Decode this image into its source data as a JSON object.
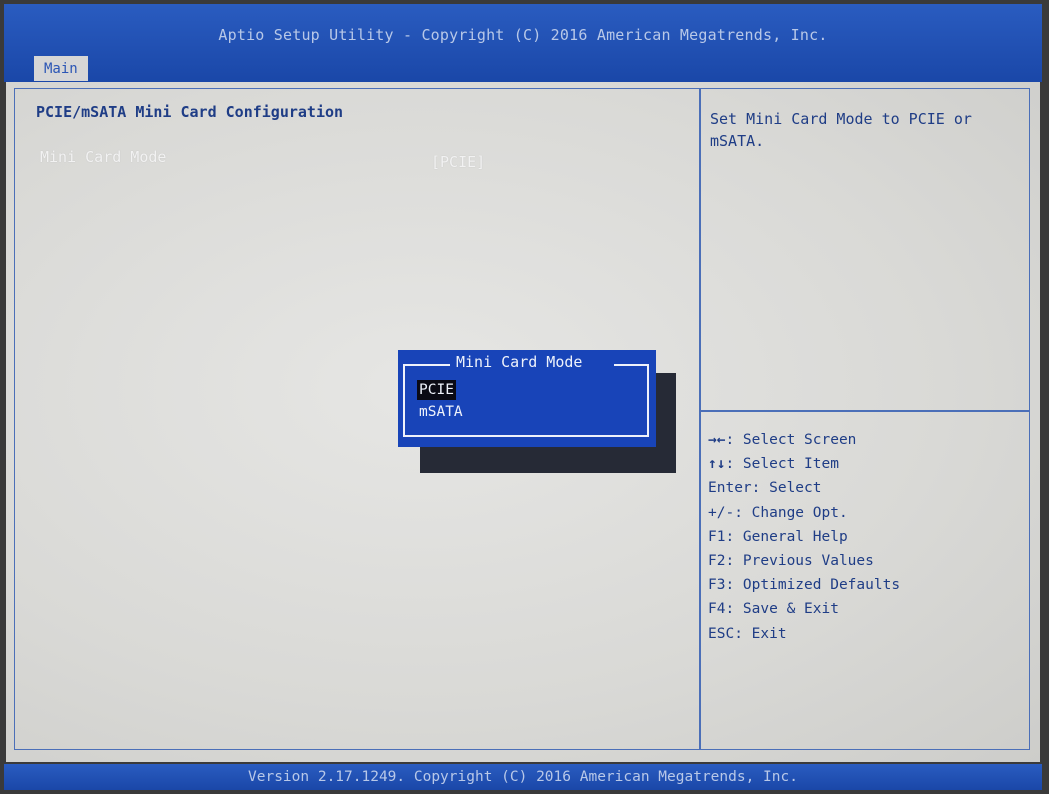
{
  "header": {
    "title": "Aptio Setup Utility - Copyright (C) 2016 American Megatrends, Inc.",
    "tabs": [
      {
        "label": "Main"
      }
    ]
  },
  "main": {
    "page_title": "PCIE/mSATA Mini Card Configuration",
    "settings": [
      {
        "label": "Mini Card Mode",
        "value": "[PCIE]"
      }
    ]
  },
  "help": {
    "text": "Set Mini Card Mode to PCIE or mSATA."
  },
  "keys": [
    {
      "key": "→←",
      "desc": ": Select Screen"
    },
    {
      "key": "↑↓",
      "desc": ": Select Item"
    },
    {
      "key": "Enter",
      "desc": ": Select"
    },
    {
      "key": "+/-",
      "desc": ": Change Opt."
    },
    {
      "key": "F1",
      "desc": ": General Help"
    },
    {
      "key": "F2",
      "desc": ": Previous Values"
    },
    {
      "key": "F3",
      "desc": ": Optimized Defaults"
    },
    {
      "key": "F4",
      "desc": ": Save & Exit"
    },
    {
      "key": "ESC",
      "desc": ": Exit"
    }
  ],
  "popup": {
    "title": "Mini Card Mode",
    "options": [
      {
        "label": "PCIE",
        "selected": true
      },
      {
        "label": "mSATA",
        "selected": false
      }
    ]
  },
  "footer": {
    "text": "Version 2.17.1249. Copyright (C) 2016 American Megatrends, Inc."
  },
  "colors": {
    "header_bg": "#1c4fb0",
    "body_bg": "#dcdcda",
    "text_dark_blue": "#1f3d86",
    "popup_bg": "#1844b8",
    "highlight_text": "#f2f2f2"
  }
}
